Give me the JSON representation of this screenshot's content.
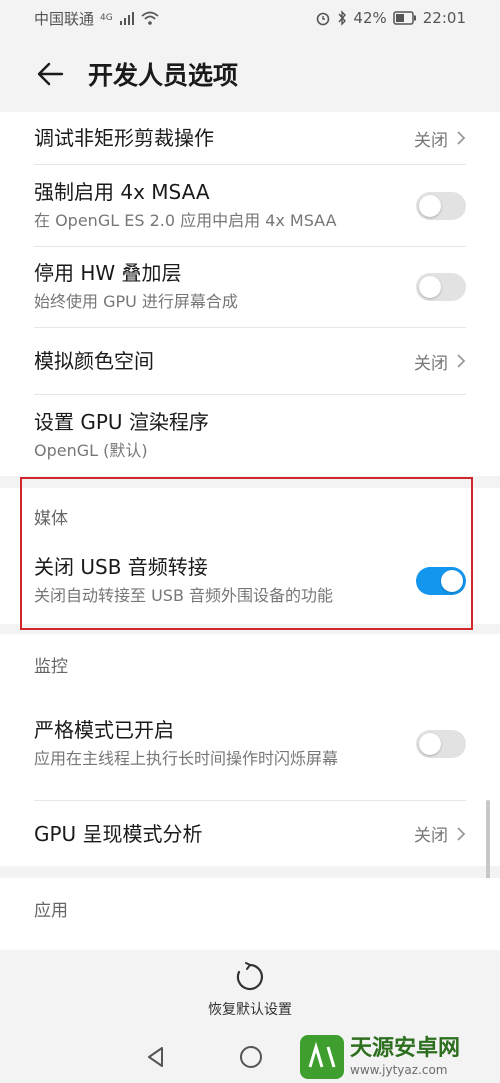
{
  "status": {
    "carrier": "中国联通",
    "network": "4G",
    "battery": "42%",
    "time": "22:01"
  },
  "header": {
    "title": "开发人员选项"
  },
  "rows": {
    "debug_nonrect": {
      "title": "调试非矩形剪裁操作",
      "value": "关闭"
    },
    "force_msaa": {
      "title": "强制启用 4x MSAA",
      "subtitle": "在 OpenGL ES 2.0 应用中启用 4x MSAA",
      "enabled": false
    },
    "disable_hw": {
      "title": "停用 HW 叠加层",
      "subtitle": "始终使用 GPU 进行屏幕合成",
      "enabled": false
    },
    "simulate_color": {
      "title": "模拟颜色空间",
      "value": "关闭"
    },
    "gpu_renderer": {
      "title": "设置 GPU 渲染程序",
      "subtitle": "OpenGL (默认)"
    },
    "usb_audio": {
      "title": "关闭 USB 音频转接",
      "subtitle": "关闭自动转接至 USB 音频外围设备的功能",
      "enabled": true
    },
    "strict_mode": {
      "title": "严格模式已开启",
      "subtitle": "应用在主线程上执行长时间操作时闪烁屏幕",
      "enabled": false
    },
    "gpu_profile": {
      "title": "GPU 呈现模式分析",
      "value": "关闭"
    }
  },
  "sections": {
    "media": "媒体",
    "monitoring": "监控",
    "apps": "应用"
  },
  "bottom": {
    "reset_label": "恢复默认设置"
  },
  "watermark": {
    "name": "天源安卓网",
    "url": "www.jytyaz.com"
  },
  "colors": {
    "accent": "#1296ee",
    "highlight": "#d1262a"
  }
}
